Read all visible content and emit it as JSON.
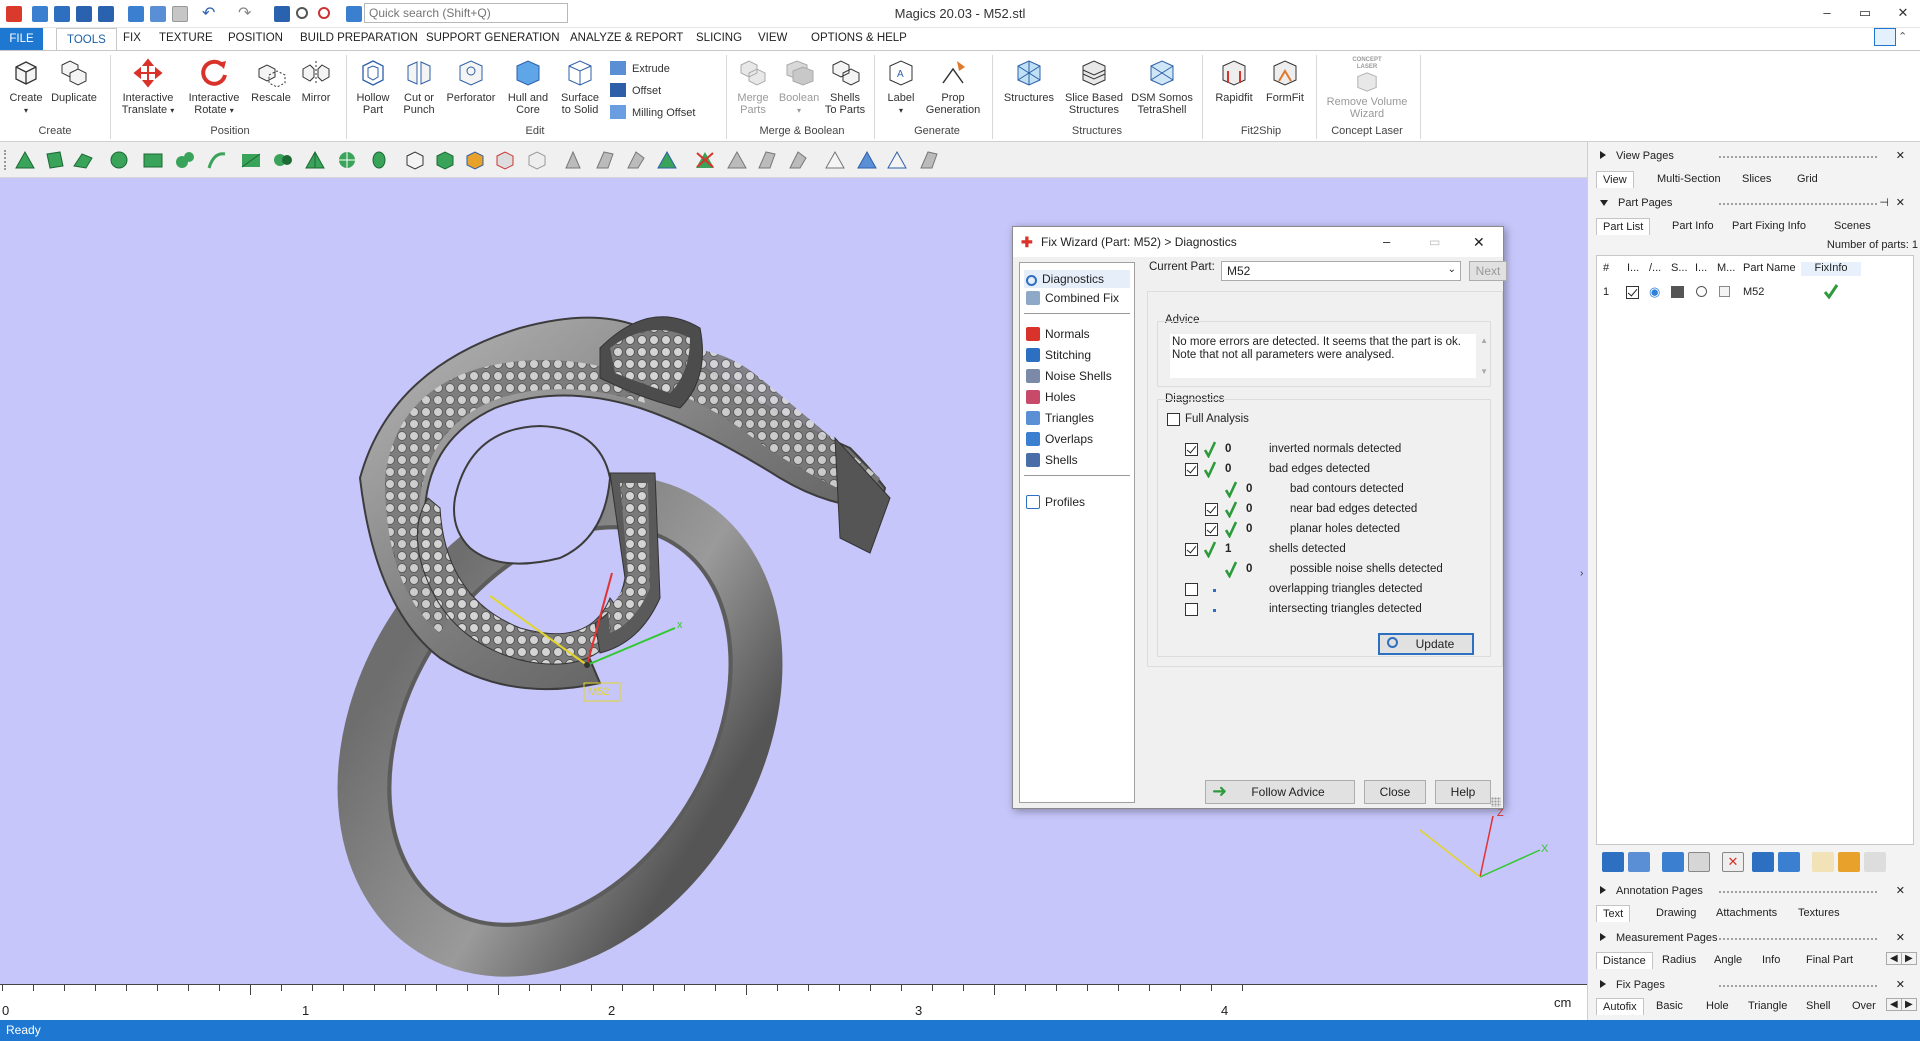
{
  "app": {
    "title": "Magics 20.03 - M52.stl",
    "search_placeholder": "Quick search (Shift+Q)",
    "window_controls": [
      "–",
      "▭",
      "✕"
    ]
  },
  "menu": {
    "tabs": [
      "FILE",
      "TOOLS",
      "FIX",
      "TEXTURE",
      "POSITION",
      "BUILD PREPARATION",
      "SUPPORT GENERATION",
      "ANALYZE & REPORT",
      "SLICING",
      "VIEW",
      "OPTIONS & HELP"
    ],
    "active": "TOOLS"
  },
  "ribbon": {
    "create": {
      "create": "Create",
      "duplicate": "Duplicate",
      "group": "Create"
    },
    "position": {
      "translate_1": "Interactive",
      "translate_2": "Translate",
      "rotate_1": "Interactive",
      "rotate_2": "Rotate",
      "rescale": "Rescale",
      "mirror": "Mirror",
      "group": "Position"
    },
    "edit": {
      "hollow_1": "Hollow",
      "hollow_2": "Part",
      "cut_1": "Cut or",
      "cut_2": "Punch",
      "perforator": "Perforator",
      "hull_1": "Hull and",
      "hull_2": "Core",
      "surface_1": "Surface",
      "surface_2": "to Solid",
      "extrude": "Extrude",
      "offset": "Offset",
      "milling": "Milling Offset",
      "group": "Edit"
    },
    "merge": {
      "merge_1": "Merge",
      "merge_2": "Parts",
      "boolean": "Boolean",
      "shells_1": "Shells",
      "shells_2": "To Parts",
      "group": "Merge & Boolean"
    },
    "generate": {
      "label": "Label",
      "prop_1": "Prop",
      "prop_2": "Generation",
      "group": "Generate"
    },
    "structures": {
      "structures": "Structures",
      "slice_1": "Slice Based",
      "slice_2": "Structures",
      "dsm_1": "DSM Somos",
      "dsm_2": "TetraShell",
      "group": "Structures"
    },
    "fit2ship": {
      "rapidfit": "Rapidfit",
      "formfit": "FormFit",
      "group": "Fit2Ship"
    },
    "concept": {
      "remove_1": "Remove Volume",
      "remove_2": "Wizard",
      "logo": "CONCEPT LASER",
      "group": "Concept Laser"
    }
  },
  "viewport": {
    "part_label": "M52",
    "axis_x": "x",
    "axis_z": "Z",
    "axis_x2": "X",
    "ruler": [
      "0",
      "1",
      "2",
      "3",
      "4"
    ],
    "unit": "cm"
  },
  "status": "Ready",
  "right_panel": {
    "view_pages": "View Pages",
    "view_tabs": [
      "View",
      "Multi-Section",
      "Slices",
      "Grid"
    ],
    "part_pages": "Part Pages",
    "part_tabs": [
      "Part List",
      "Part Info",
      "Part Fixing Info",
      "Scenes"
    ],
    "num_parts": "Number of parts: 1",
    "columns": [
      "#",
      "I...",
      "/...",
      "S...",
      "I...",
      "M...",
      "Part Name",
      "FixInfo"
    ],
    "rows": [
      {
        "num": "1",
        "name": "M52"
      }
    ],
    "annotation_pages": "Annotation Pages",
    "annotation_tabs": [
      "Text",
      "Drawing",
      "Attachments",
      "Textures"
    ],
    "measurement_pages": "Measurement Pages",
    "measurement_tabs": [
      "Distance",
      "Radius",
      "Angle",
      "Info",
      "Final Part"
    ],
    "fix_pages": "Fix Pages",
    "fix_tabs": [
      "Autofix",
      "Basic",
      "Hole",
      "Triangle",
      "Shell",
      "Over"
    ]
  },
  "dialog": {
    "title": "Fix Wizard (Part: M52) > Diagnostics",
    "nav": [
      "Diagnostics",
      "Combined Fix",
      "Normals",
      "Stitching",
      "Noise Shells",
      "Holes",
      "Triangles",
      "Overlaps",
      "Shells",
      "Profiles"
    ],
    "current_part_label": "Current Part:",
    "current_part": "M52",
    "next": "Next",
    "advice_title": "Advice",
    "advice_text_1": "No more errors are detected. It seems that the part is ok.",
    "advice_text_2": "Note that not all parameters were analysed.",
    "diag_title": "Diagnostics",
    "full_analysis": "Full Analysis",
    "items": [
      {
        "value": "0",
        "label": "inverted normals detected"
      },
      {
        "value": "0",
        "label": "bad edges detected"
      },
      {
        "value": "0",
        "label": "bad contours detected"
      },
      {
        "value": "0",
        "label": "near bad edges detected"
      },
      {
        "value": "0",
        "label": "planar holes detected"
      },
      {
        "value": "1",
        "label": "shells detected"
      },
      {
        "value": "0",
        "label": "possible noise shells detected"
      },
      {
        "value": "",
        "label": "overlapping triangles detected"
      },
      {
        "value": "",
        "label": "intersecting triangles detected"
      }
    ],
    "update": "Update",
    "follow_advice": "Follow Advice",
    "close": "Close",
    "help": "Help"
  }
}
